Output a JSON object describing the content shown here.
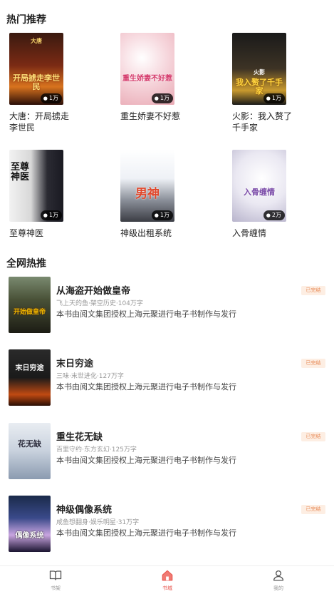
{
  "sections": {
    "hot": {
      "title": "热门推荐"
    },
    "all": {
      "title": "全网热推"
    }
  },
  "hot_books": [
    {
      "title": "大唐：开局掳走李世民",
      "count": "1万",
      "cover_text": "开局掳走李世民",
      "cover_top": "大唐"
    },
    {
      "title": "重生娇妻不好惹",
      "count": "1万",
      "cover_text": "重生娇妻不好惹",
      "cover_top": ""
    },
    {
      "title": "火影：我入赘了千手家",
      "count": "1万",
      "cover_text": "我入赘了千手家",
      "cover_top": "火影"
    },
    {
      "title": "至尊神医",
      "count": "1万",
      "cover_text": "至尊神医",
      "cover_top": ""
    },
    {
      "title": "神级出租系统",
      "count": "1万",
      "cover_text": "男神",
      "cover_top": ""
    },
    {
      "title": "入骨缠情",
      "count": "2万",
      "cover_text": "入骨缠情",
      "cover_top": ""
    }
  ],
  "all_books": [
    {
      "title": "从海盗开始做皇帝",
      "meta": "飞上天的鱼·架空历史·104万字",
      "desc": "本书由阅文集团授权上海元聚进行电子书制作与发行",
      "status": "已完结",
      "cover_text": "开始做皇帝"
    },
    {
      "title": "末日穷途",
      "meta": "三味·末世进化·127万字",
      "desc": "本书由阅文集团授权上海元聚进行电子书制作与发行",
      "status": "已完结",
      "cover_text": "末日穷途"
    },
    {
      "title": "重生花无缺",
      "meta": "百里守约·东方玄幻·125万字",
      "desc": "本书由阅文集团授权上海元聚进行电子书制作与发行",
      "status": "已完结",
      "cover_text": "花无缺"
    },
    {
      "title": "神级偶像系统",
      "meta": "咸鱼想翻身·娱乐明星·31万字",
      "desc": "本书由阅文集团授权上海元聚进行电子书制作与发行",
      "status": "已完结",
      "cover_text": "偶像系统"
    }
  ],
  "tabs": [
    {
      "label": "书架",
      "icon": "book-open-icon",
      "active": false
    },
    {
      "label": "书城",
      "icon": "home-icon",
      "active": true
    },
    {
      "label": "我的",
      "icon": "user-icon",
      "active": false
    }
  ],
  "colors": {
    "accent": "#e8554d",
    "status_bg": "#fdeee3",
    "status_text": "#e88b57"
  }
}
